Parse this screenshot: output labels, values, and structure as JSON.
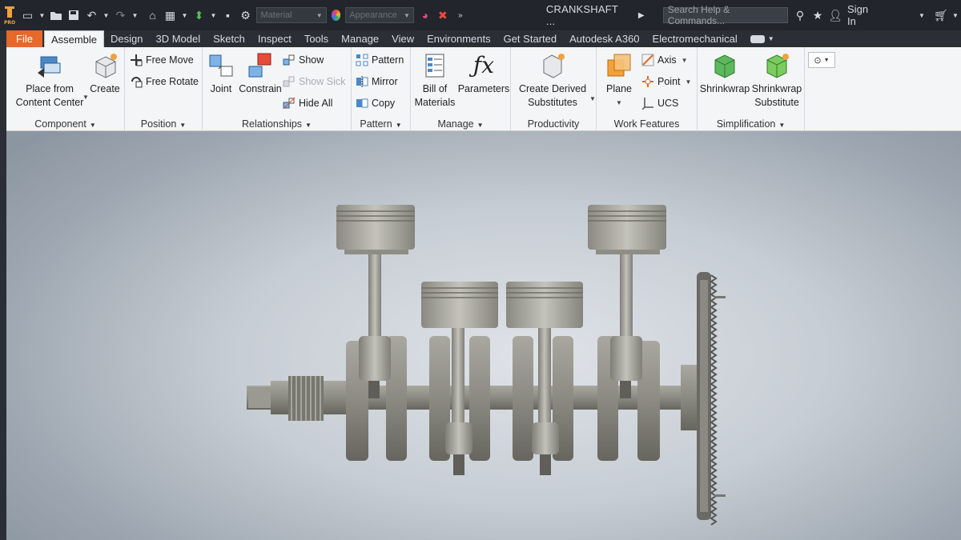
{
  "qat": {
    "material_placeholder": "Material",
    "appearance_placeholder": "Appearance",
    "document_title": "CRANKSHAFT ...",
    "search_placeholder": "Search Help & Commands...",
    "sign_in": "Sign In",
    "product_badge": "PRO"
  },
  "tabs": [
    "File",
    "Assemble",
    "Design",
    "3D Model",
    "Sketch",
    "Inspect",
    "Tools",
    "Manage",
    "View",
    "Environments",
    "Get Started",
    "Autodesk A360",
    "Electromechanical"
  ],
  "active_tab": "Assemble",
  "ribbon": {
    "component": {
      "title": "Component",
      "place_line1": "Place from",
      "place_line2": "Content Center",
      "create": "Create"
    },
    "position": {
      "title": "Position",
      "free_move": "Free Move",
      "free_rotate": "Free Rotate"
    },
    "relationships": {
      "title": "Relationships",
      "joint": "Joint",
      "constrain": "Constrain",
      "show": "Show",
      "show_sick": "Show Sick",
      "hide_all": "Hide All"
    },
    "pattern": {
      "title": "Pattern",
      "pattern": "Pattern",
      "mirror": "Mirror",
      "copy": "Copy"
    },
    "manage": {
      "title": "Manage",
      "bom_line1": "Bill of",
      "bom_line2": "Materials",
      "parameters": "Parameters"
    },
    "productivity": {
      "title": "Productivity",
      "derived_line1": "Create Derived",
      "derived_line2": "Substitutes"
    },
    "work_features": {
      "title": "Work Features",
      "plane": "Plane",
      "axis": "Axis",
      "point": "Point",
      "ucs": "UCS"
    },
    "simplification": {
      "title": "Simplification",
      "shrinkwrap": "Shrinkwrap",
      "sw_sub_line1": "Shrinkwrap",
      "sw_sub_line2": "Substitute"
    }
  },
  "colors": {
    "file_tab": "#e8672a",
    "titlebar": "#22262c",
    "ribbon": "#f4f5f6",
    "part_metal": "#8f8e86"
  }
}
